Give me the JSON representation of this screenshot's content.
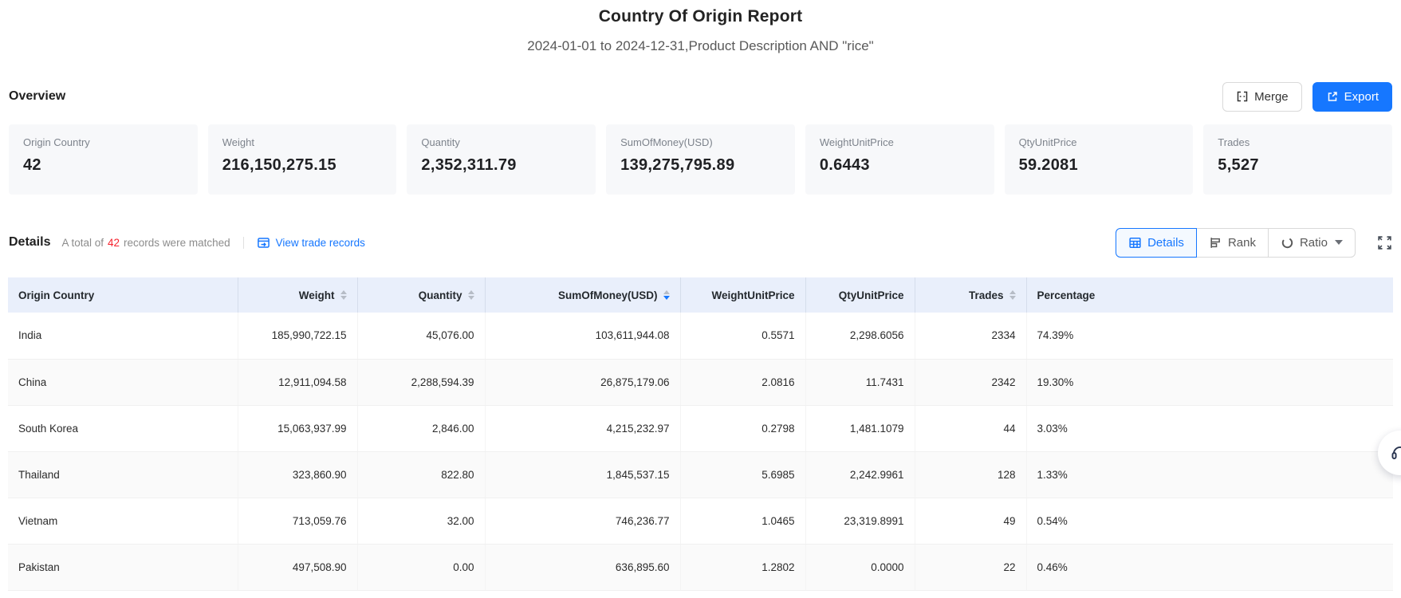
{
  "colors": {
    "accent": "#1677ff",
    "danger": "#f5222d",
    "thbg": "#e9effb",
    "card-bg": "#f7f8fa",
    "border": "#d9d9d9",
    "muted": "#8c8c8c",
    "row-alt": "#fafafa",
    "line": "#f0f0f0"
  },
  "page": {
    "title": "Country Of Origin Report",
    "subtitle": "2024-01-01 to 2024-12-31,Product Description AND \"rice\""
  },
  "overview": {
    "heading": "Overview",
    "merge_label": "Merge",
    "export_label": "Export",
    "cards": [
      {
        "label": "Origin Country",
        "value": "42"
      },
      {
        "label": "Weight",
        "value": "216,150,275.15"
      },
      {
        "label": "Quantity",
        "value": "2,352,311.79"
      },
      {
        "label": "SumOfMoney(USD)",
        "value": "139,275,795.89"
      },
      {
        "label": "WeightUnitPrice",
        "value": "0.6443"
      },
      {
        "label": "QtyUnitPrice",
        "value": "59.2081"
      },
      {
        "label": "Trades",
        "value": "5,527"
      }
    ]
  },
  "details": {
    "heading": "Details",
    "matched_prefix": "A total of",
    "matched_count": "42",
    "matched_suffix": "records were matched",
    "view_link": "View trade records",
    "view_modes": {
      "details": "Details",
      "rank": "Rank",
      "ratio": "Ratio"
    },
    "active_mode": "Details"
  },
  "icons": {
    "merge": "merge-cells-icon",
    "export": "export-arrow-icon",
    "view_records": "trade-records-icon",
    "details_mode": "table-grid-icon",
    "rank_mode": "rank-bars-icon",
    "ratio_mode": "donut-ring-icon",
    "ratio_caret": "caret-down-icon",
    "fullscreen": "expand-icon",
    "sort": "sort-carets-icon",
    "support": "headset-icon"
  },
  "table": {
    "columns": [
      {
        "label": "Origin Country",
        "align": "left",
        "sortable": false,
        "sort": null
      },
      {
        "label": "Weight",
        "align": "right",
        "sortable": true,
        "sort": null
      },
      {
        "label": "Quantity",
        "align": "right",
        "sortable": true,
        "sort": null
      },
      {
        "label": "SumOfMoney(USD)",
        "align": "right",
        "sortable": true,
        "sort": "desc"
      },
      {
        "label": "WeightUnitPrice",
        "align": "right",
        "sortable": false,
        "sort": null
      },
      {
        "label": "QtyUnitPrice",
        "align": "right",
        "sortable": false,
        "sort": null
      },
      {
        "label": "Trades",
        "align": "right",
        "sortable": true,
        "sort": null
      },
      {
        "label": "Percentage",
        "align": "left",
        "sortable": false,
        "sort": null
      }
    ],
    "rows": [
      [
        "India",
        "185,990,722.15",
        "45,076.00",
        "103,611,944.08",
        "0.5571",
        "2,298.6056",
        "2334",
        "74.39%"
      ],
      [
        "China",
        "12,911,094.58",
        "2,288,594.39",
        "26,875,179.06",
        "2.0816",
        "11.7431",
        "2342",
        "19.30%"
      ],
      [
        "South Korea",
        "15,063,937.99",
        "2,846.00",
        "4,215,232.97",
        "0.2798",
        "1,481.1079",
        "44",
        "3.03%"
      ],
      [
        "Thailand",
        "323,860.90",
        "822.80",
        "1,845,537.15",
        "5.6985",
        "2,242.9961",
        "128",
        "1.33%"
      ],
      [
        "Vietnam",
        "713,059.76",
        "32.00",
        "746,236.77",
        "1.0465",
        "23,319.8991",
        "49",
        "0.54%"
      ],
      [
        "Pakistan",
        "497,508.90",
        "0.00",
        "636,895.60",
        "1.2802",
        "0.0000",
        "22",
        "0.46%"
      ]
    ]
  }
}
